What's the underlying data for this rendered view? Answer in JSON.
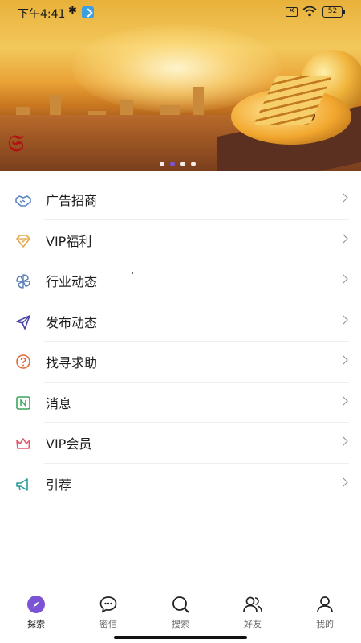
{
  "status_bar": {
    "time": "下午4:41",
    "battery": "52"
  },
  "banner": {
    "slide_count": 4,
    "active_index": 1
  },
  "menu": [
    {
      "label": "广告招商",
      "icon": "handshake-icon",
      "color": "#5b86c5"
    },
    {
      "label": "VIP福利",
      "icon": "diamond-icon",
      "color": "#e6a94a"
    },
    {
      "label": "行业动态",
      "icon": "pinwheel-icon",
      "color": "#5b7fb8"
    },
    {
      "label": "发布动态",
      "icon": "paper-plane-icon",
      "color": "#4b46a8"
    },
    {
      "label": "找寻求助",
      "icon": "help-bubble-icon",
      "color": "#e06a3c"
    },
    {
      "label": "消息",
      "icon": "message-icon",
      "color": "#3aa55a"
    },
    {
      "label": "VIP会员",
      "icon": "crown-icon",
      "color": "#e05a6a"
    },
    {
      "label": "引荐",
      "icon": "megaphone-icon",
      "color": "#2a9a9a"
    }
  ],
  "tabs": [
    {
      "label": "探索",
      "icon": "compass-icon",
      "active": true
    },
    {
      "label": "密信",
      "icon": "chat-icon",
      "active": false
    },
    {
      "label": "搜索",
      "icon": "search-icon",
      "active": false
    },
    {
      "label": "好友",
      "icon": "friends-icon",
      "active": false
    },
    {
      "label": "我的",
      "icon": "profile-icon",
      "active": false
    }
  ],
  "colors": {
    "accent": "#7b54d6",
    "divider": "#efefef"
  }
}
